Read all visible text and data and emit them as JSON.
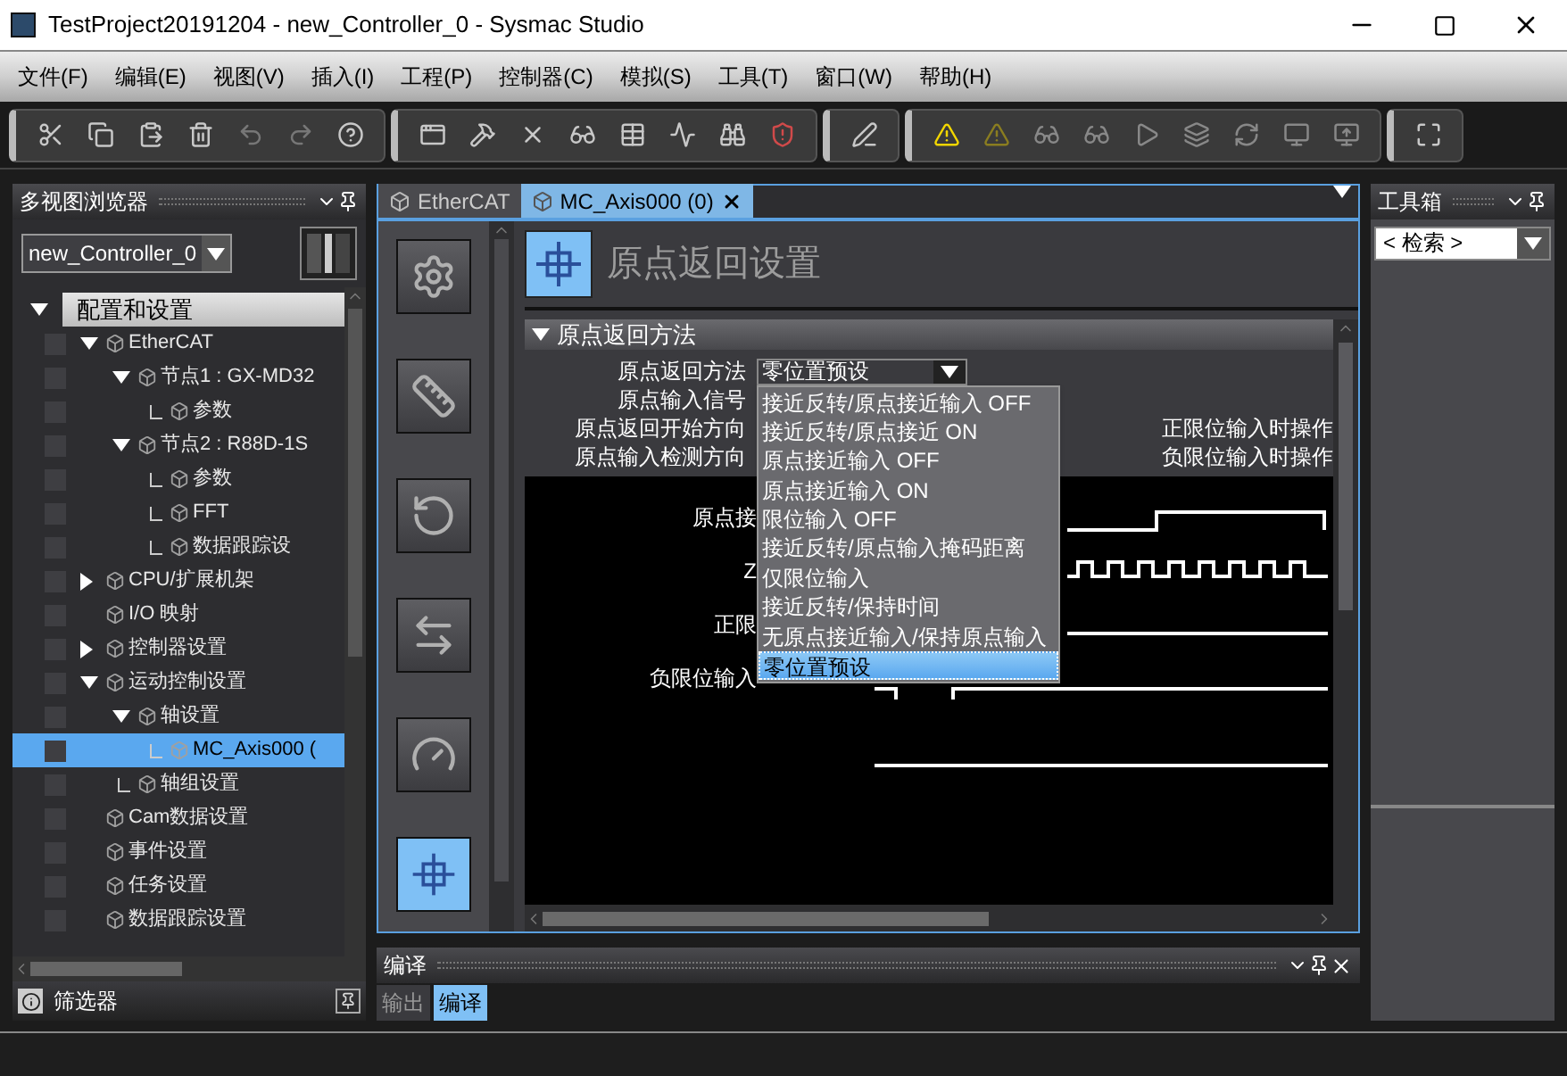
{
  "window": {
    "title": "TestProject20191204 - new_Controller_0 - Sysmac Studio"
  },
  "menu": [
    "文件(F)",
    "编辑(E)",
    "视图(V)",
    "插入(I)",
    "工程(P)",
    "控制器(C)",
    "模拟(S)",
    "工具(T)",
    "窗口(W)",
    "帮助(H)"
  ],
  "explorer": {
    "title": "多视图浏览器",
    "controller": "new_Controller_0",
    "filter_label": "筛选器",
    "tree": [
      {
        "label": "配置和设置",
        "kind": "root",
        "expanded": true,
        "selected": false,
        "children": [
          {
            "label": "EtherCAT",
            "kind": "branch",
            "expanded": true,
            "selected": false,
            "children": [
              {
                "label": "节点1 : GX-MD32",
                "kind": "branch",
                "expanded": true,
                "selected": false,
                "children": [
                  {
                    "label": "参数",
                    "kind": "leaf",
                    "selected": false
                  }
                ]
              },
              {
                "label": "节点2 : R88D-1S",
                "kind": "branch",
                "expanded": true,
                "selected": false,
                "children": [
                  {
                    "label": "参数",
                    "kind": "leaf",
                    "selected": false
                  },
                  {
                    "label": "FFT",
                    "kind": "leaf",
                    "selected": false
                  },
                  {
                    "label": "数据跟踪设",
                    "kind": "leaf",
                    "selected": false
                  }
                ]
              }
            ]
          },
          {
            "label": "CPU/扩展机架",
            "kind": "branch",
            "expanded": false,
            "selected": false
          },
          {
            "label": "I/O 映射",
            "kind": "item",
            "selected": false
          },
          {
            "label": "控制器设置",
            "kind": "branch",
            "expanded": false,
            "selected": false
          },
          {
            "label": "运动控制设置",
            "kind": "branch",
            "expanded": true,
            "selected": false,
            "children": [
              {
                "label": "轴设置",
                "kind": "branch",
                "expanded": true,
                "selected": false,
                "children": [
                  {
                    "label": "MC_Axis000 (",
                    "kind": "leaf",
                    "selected": true
                  }
                ]
              },
              {
                "label": "轴组设置",
                "kind": "leaf",
                "selected": false
              }
            ]
          },
          {
            "label": "Cam数据设置",
            "kind": "item",
            "selected": false
          },
          {
            "label": "事件设置",
            "kind": "item",
            "selected": false
          },
          {
            "label": "任务设置",
            "kind": "item",
            "selected": false
          },
          {
            "label": "数据跟踪设置",
            "kind": "item",
            "selected": false
          }
        ]
      }
    ]
  },
  "editor": {
    "tabs": [
      {
        "label": "EtherCAT",
        "selected": false,
        "closable": false
      },
      {
        "label": "MC_Axis000 (0)",
        "selected": true,
        "closable": true
      }
    ],
    "side_buttons": [
      {
        "kind": "settings",
        "selected": false
      },
      {
        "kind": "scale",
        "selected": false
      },
      {
        "kind": "rotate",
        "selected": false
      },
      {
        "kind": "transfer",
        "selected": false
      },
      {
        "kind": "gauge",
        "selected": false
      },
      {
        "kind": "origin",
        "selected": true
      }
    ],
    "title": "原点返回设置",
    "section": {
      "title": "原点返回方法",
      "expanded": true
    },
    "fields": [
      {
        "label": "原点返回方法",
        "value": "零位置预设",
        "open": true,
        "options": [
          {
            "label": "接近反转/原点接近输入 OFF",
            "selected": false
          },
          {
            "label": "接近反转/原点接近 ON",
            "selected": false
          },
          {
            "label": "原点接近输入 OFF",
            "selected": false
          },
          {
            "label": "原点接近输入 ON",
            "selected": false
          },
          {
            "label": "限位输入 OFF",
            "selected": false
          },
          {
            "label": "接近反转/原点输入掩码距离",
            "selected": false
          },
          {
            "label": "仅限位输入",
            "selected": false
          },
          {
            "label": "接近反转/保持时间",
            "selected": false
          },
          {
            "label": "无原点接近输入/保持原点输入",
            "selected": false
          },
          {
            "label": "零位置预设",
            "selected": true
          }
        ]
      },
      {
        "label": "原点输入信号"
      },
      {
        "label": "原点返回开始方向",
        "right_label": "正限位输入时操作"
      },
      {
        "label": "原点输入检测方向",
        "right_label": "负限位输入时操作"
      }
    ],
    "diagram_labels": [
      "原点接",
      "Z",
      "正限",
      "负限位输入"
    ]
  },
  "compile_panel": {
    "title": "编译",
    "tabs": [
      {
        "label": "输出",
        "selected": false
      },
      {
        "label": "编译",
        "selected": true
      }
    ]
  },
  "toolbox": {
    "title": "工具箱",
    "search": "< 检索 >"
  }
}
